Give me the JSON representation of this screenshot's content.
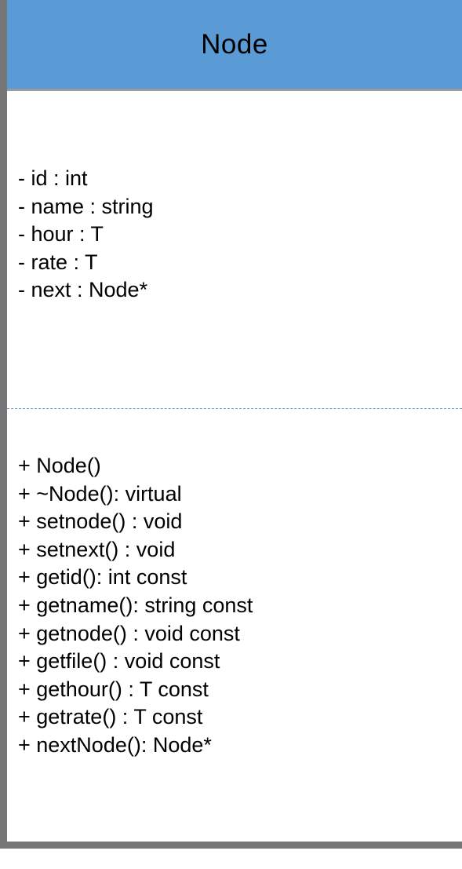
{
  "class": {
    "name": "Node",
    "attributes": [
      "- id : int",
      "- name : string",
      "- hour : T",
      "- rate : T",
      "- next : Node*"
    ],
    "methods": [
      "+ Node()",
      "+ ~Node(): virtual",
      "+ setnode() : void",
      "+ setnext() : void",
      "+ getid(): int const",
      "+ getname(): string const",
      "+ getnode() : void const",
      "+ getfile() : void const",
      "+ gethour() : T const",
      "+ getrate() : T const",
      "+ nextNode(): Node*"
    ]
  },
  "colors": {
    "header": "#5b9bd5",
    "divider": "#5b9bd5",
    "frame_shadow": "#777777"
  }
}
